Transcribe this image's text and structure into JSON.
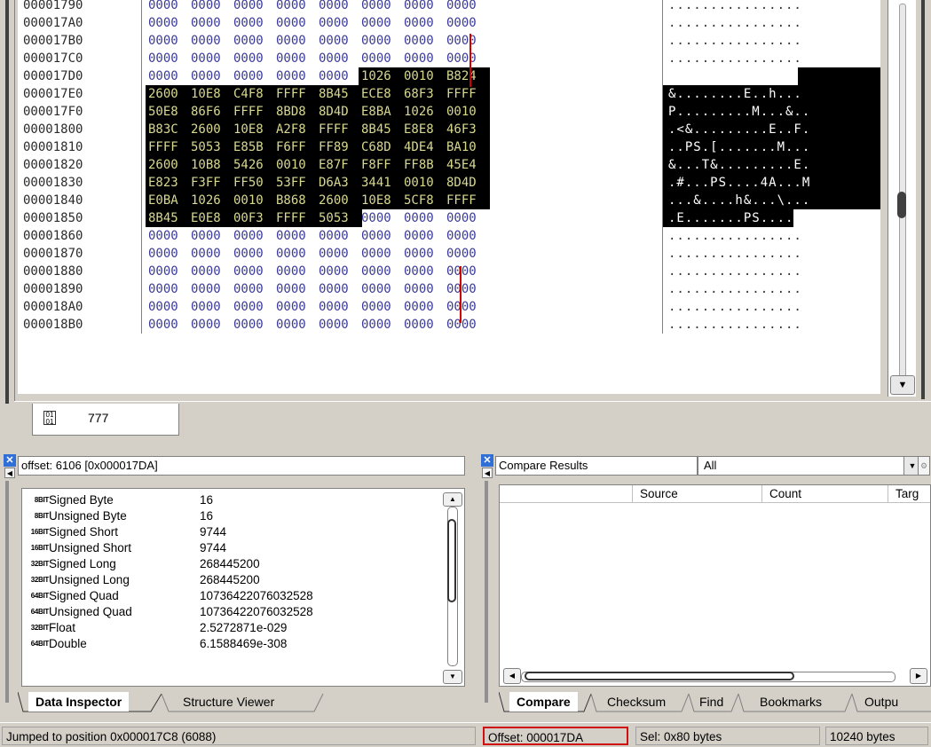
{
  "hex_view": {
    "rows": [
      {
        "addr": "00001790",
        "words": [
          "0000",
          "0000",
          "0000",
          "0000",
          "0000",
          "0000",
          "0000",
          "0000"
        ],
        "ascii": "................",
        "sel_from": -1,
        "sel_to": -1
      },
      {
        "addr": "000017A0",
        "words": [
          "0000",
          "0000",
          "0000",
          "0000",
          "0000",
          "0000",
          "0000",
          "0000"
        ],
        "ascii": "................",
        "sel_from": -1,
        "sel_to": -1
      },
      {
        "addr": "000017B0",
        "words": [
          "0000",
          "0000",
          "0000",
          "0000",
          "0000",
          "0000",
          "0000",
          "0000"
        ],
        "ascii": "................",
        "sel_from": -1,
        "sel_to": -1
      },
      {
        "addr": "000017C0",
        "words": [
          "0000",
          "0000",
          "0000",
          "0000",
          "0000",
          "0000",
          "0000",
          "0000"
        ],
        "ascii": "................",
        "sel_from": -1,
        "sel_to": -1
      },
      {
        "addr": "000017D0",
        "words": [
          "0000",
          "0000",
          "0000",
          "0000",
          "0000",
          "1026",
          "0010",
          "B824"
        ],
        "ascii": "..........&...$",
        "sel_from": 5,
        "sel_to": 7
      },
      {
        "addr": "000017E0",
        "words": [
          "2600",
          "10E8",
          "C4F8",
          "FFFF",
          "8B45",
          "ECE8",
          "68F3",
          "FFFF"
        ],
        "ascii": "&........E..h...",
        "sel_from": 0,
        "sel_to": 7
      },
      {
        "addr": "000017F0",
        "words": [
          "50E8",
          "86F6",
          "FFFF",
          "8BD8",
          "8D4D",
          "E8BA",
          "1026",
          "0010"
        ],
        "ascii": "P.........M...&..",
        "sel_from": 0,
        "sel_to": 7
      },
      {
        "addr": "00001800",
        "words": [
          "B83C",
          "2600",
          "10E8",
          "A2F8",
          "FFFF",
          "8B45",
          "E8E8",
          "46F3"
        ],
        "ascii": ".<&.........E..F.",
        "sel_from": 0,
        "sel_to": 7
      },
      {
        "addr": "00001810",
        "words": [
          "FFFF",
          "5053",
          "E85B",
          "F6FF",
          "FF89",
          "C68D",
          "4DE4",
          "BA10"
        ],
        "ascii": "..PS.[.......M...",
        "sel_from": 0,
        "sel_to": 7
      },
      {
        "addr": "00001820",
        "words": [
          "2600",
          "10B8",
          "5426",
          "0010",
          "E87F",
          "F8FF",
          "FF8B",
          "45E4"
        ],
        "ascii": "&...T&.........E.",
        "sel_from": 0,
        "sel_to": 7
      },
      {
        "addr": "00001830",
        "words": [
          "E823",
          "F3FF",
          "FF50",
          "53FF",
          "D6A3",
          "3441",
          "0010",
          "8D4D"
        ],
        "ascii": ".#...PS....4A...M",
        "sel_from": 0,
        "sel_to": 7
      },
      {
        "addr": "00001840",
        "words": [
          "E0BA",
          "1026",
          "0010",
          "B868",
          "2600",
          "10E8",
          "5CF8",
          "FFFF"
        ],
        "ascii": "...&....h&...\\...",
        "sel_from": 0,
        "sel_to": 7
      },
      {
        "addr": "00001850",
        "words": [
          "8B45",
          "E0E8",
          "00F3",
          "FFFF",
          "5053",
          "0000",
          "0000",
          "0000"
        ],
        "ascii": ".E.......PS......",
        "sel_from": 0,
        "sel_to": 4
      },
      {
        "addr": "00001860",
        "words": [
          "0000",
          "0000",
          "0000",
          "0000",
          "0000",
          "0000",
          "0000",
          "0000"
        ],
        "ascii": "................",
        "sel_from": -1,
        "sel_to": -1
      },
      {
        "addr": "00001870",
        "words": [
          "0000",
          "0000",
          "0000",
          "0000",
          "0000",
          "0000",
          "0000",
          "0000"
        ],
        "ascii": "................",
        "sel_from": -1,
        "sel_to": -1
      },
      {
        "addr": "00001880",
        "words": [
          "0000",
          "0000",
          "0000",
          "0000",
          "0000",
          "0000",
          "0000",
          "0000"
        ],
        "ascii": "................",
        "sel_from": -1,
        "sel_to": -1
      },
      {
        "addr": "00001890",
        "words": [
          "0000",
          "0000",
          "0000",
          "0000",
          "0000",
          "0000",
          "0000",
          "0000"
        ],
        "ascii": "................",
        "sel_from": -1,
        "sel_to": -1
      },
      {
        "addr": "000018A0",
        "words": [
          "0000",
          "0000",
          "0000",
          "0000",
          "0000",
          "0000",
          "0000",
          "0000"
        ],
        "ascii": "................",
        "sel_from": -1,
        "sel_to": -1
      },
      {
        "addr": "000018B0",
        "words": [
          "0000",
          "0000",
          "0000",
          "0000",
          "0000",
          "0000",
          "0000",
          "0000"
        ],
        "ascii": "................",
        "sel_from": -1,
        "sel_to": -1
      }
    ]
  },
  "file_tab": {
    "label": "777",
    "icon": "binary-file-icon"
  },
  "data_inspector": {
    "header": "offset: 6106 [0x000017DA]",
    "rows": [
      {
        "badge": "8BIT",
        "name": "Signed Byte",
        "value": "16"
      },
      {
        "badge": "8BIT",
        "name": "Unsigned Byte",
        "value": "16"
      },
      {
        "badge": "16BIT",
        "name": "Signed Short",
        "value": "9744"
      },
      {
        "badge": "16BIT",
        "name": "Unsigned Short",
        "value": "9744"
      },
      {
        "badge": "32BIT",
        "name": "Signed Long",
        "value": "268445200"
      },
      {
        "badge": "32BIT",
        "name": "Unsigned Long",
        "value": "268445200"
      },
      {
        "badge": "64BIT",
        "name": "Signed Quad",
        "value": "10736422076032528"
      },
      {
        "badge": "64BIT",
        "name": "Unsigned Quad",
        "value": "10736422076032528"
      },
      {
        "badge": "32BIT",
        "name": "Float",
        "value": "2.5272871e-029"
      },
      {
        "badge": "64BIT",
        "name": "Double",
        "value": "6.1588469e-308"
      }
    ],
    "tabs": [
      "Data Inspector",
      "Structure Viewer"
    ]
  },
  "compare_results": {
    "header": "Compare Results",
    "filter_value": "All",
    "columns": [
      "Source",
      "Count",
      "Targ"
    ],
    "tabs": [
      "Compare",
      "Checksum",
      "Find",
      "Bookmarks",
      "Outpu"
    ]
  },
  "status_bar": {
    "message": "Jumped to position 0x000017C8 (6088)",
    "offset": "Offset: 000017DA",
    "selection": "Sel: 0x80 bytes",
    "file_size": "10240 bytes"
  },
  "colors": {
    "selection_bg": "#000000",
    "selection_fg": "#d8d890",
    "hex_fg": "#3a3a9a",
    "highlight_red": "#d01010",
    "close_blue": "#2f6fd6"
  }
}
